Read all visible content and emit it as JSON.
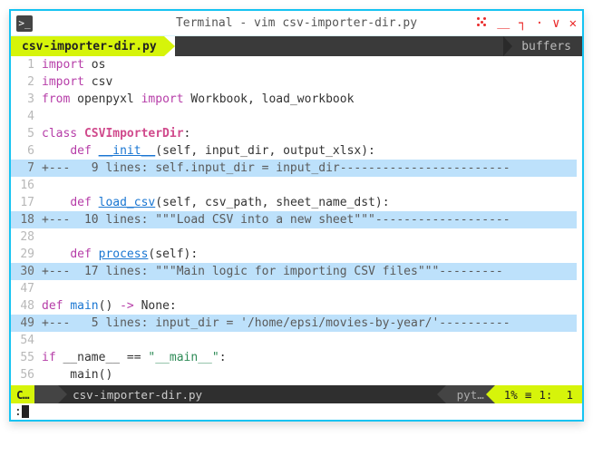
{
  "window": {
    "title": "Terminal - vim csv-importer-dir.py",
    "icon_glyph": ">_"
  },
  "bufferline": {
    "filename": "csv-importer-dir.py",
    "right_label": "buffers"
  },
  "lines": [
    {
      "n": 1,
      "type": "code",
      "html": "<span class='kw-import'>import</span> os"
    },
    {
      "n": 2,
      "type": "code",
      "html": "<span class='kw-import'>import</span> csv"
    },
    {
      "n": 3,
      "type": "code",
      "html": "<span class='kw-from'>from</span> openpyxl <span class='kw-import'>import</span> Workbook, load_workbook"
    },
    {
      "n": 4,
      "type": "blank"
    },
    {
      "n": 5,
      "type": "code",
      "html": "<span class='kw-class'>class</span> <span class='ident-cls'>CSVImporterDir</span>:"
    },
    {
      "n": 6,
      "type": "code",
      "html": "    <span class='kw-def'>def</span> <span class='ident-fn'>__init__</span>(self, input_dir, output_xlsx):"
    },
    {
      "n": 7,
      "type": "fold",
      "text": "+---   9 lines: self.input_dir = input_dir------------------------"
    },
    {
      "n": 16,
      "type": "blank"
    },
    {
      "n": 17,
      "type": "code",
      "html": "    <span class='kw-def'>def</span> <span class='ident-fn'>load_csv</span>(self, csv_path, sheet_name_dst):"
    },
    {
      "n": 18,
      "type": "fold",
      "text": "+---  10 lines: \"\"\"Load CSV into a new sheet\"\"\"-------------------"
    },
    {
      "n": 28,
      "type": "blank"
    },
    {
      "n": 29,
      "type": "code",
      "html": "    <span class='kw-def'>def</span> <span class='ident-fn'>process</span>(self):"
    },
    {
      "n": 30,
      "type": "fold",
      "text": "+---  17 lines: \"\"\"Main logic for importing CSV files\"\"\"---------"
    },
    {
      "n": 47,
      "type": "blank"
    },
    {
      "n": 48,
      "type": "code",
      "html": "<span class='kw-def'>def</span> <span class='ident-main'>main</span>() <span class='arrow'>-&gt;</span> None:"
    },
    {
      "n": 49,
      "type": "fold",
      "text": "+---   5 lines: input_dir = '/home/epsi/movies-by-year/'----------"
    },
    {
      "n": 54,
      "type": "blank"
    },
    {
      "n": 55,
      "type": "code",
      "html": "<span class='kw-if'>if</span> __name__ == <span class='str'>\"__main__\"</span>:"
    },
    {
      "n": 56,
      "type": "code",
      "html": "    main()"
    }
  ],
  "statusline": {
    "mode": "C…",
    "branch_glyph": "",
    "filename": "csv-importer-dir.py",
    "filetype": "pyt…",
    "percent": "1%",
    "lineno": "1",
    "colno": "1"
  },
  "cmdline": {
    "prefix": ":"
  }
}
